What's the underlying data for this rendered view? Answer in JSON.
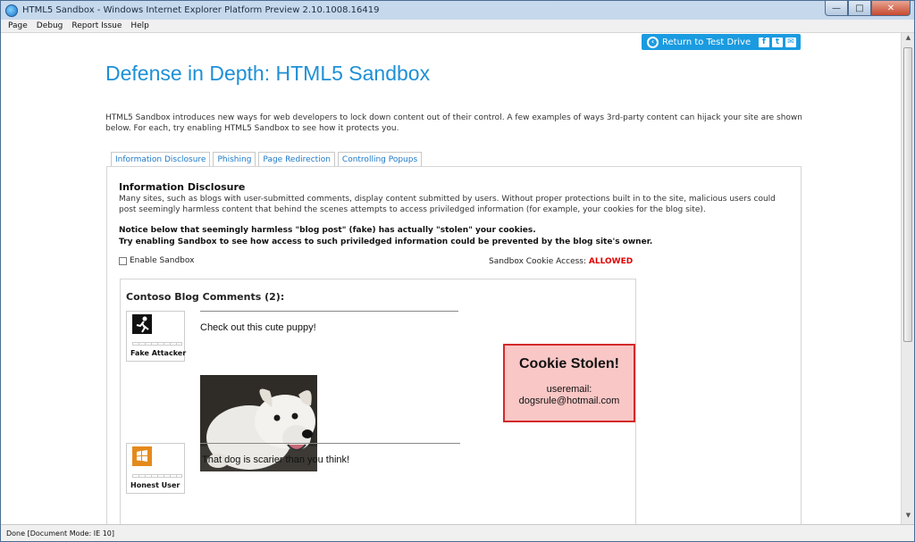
{
  "window": {
    "title": "HTML5 Sandbox - Windows Internet Explorer Platform Preview 2.10.1008.16419"
  },
  "menu": [
    "Page",
    "Debug",
    "Report Issue",
    "Help"
  ],
  "toolbar": {
    "return_label": "Return to Test Drive"
  },
  "page": {
    "title": "Defense in Depth: HTML5 Sandbox",
    "intro": "HTML5 Sandbox introduces new ways for web developers to lock down content out of their control. A few examples of ways 3rd-party content can hijack your site are shown below. For each, try enabling HTML5 Sandbox to see how it protects you."
  },
  "tabs": [
    "Information Disclosure",
    "Phishing",
    "Page Redirection",
    "Controlling Popups"
  ],
  "panel": {
    "title": "Information Disclosure",
    "description": "Many sites, such as blogs with user-submitted comments, display content submitted by users. Without proper protections built in to the site, malicious users could post seemingly harmless content that behind the scenes attempts to access priviledged information (for example, your cookies for the blog site).",
    "notice_line1": "Notice below that seemingly harmless \"blog post\" (fake) has actually \"stolen\" your cookies.",
    "notice_line2": "Try enabling Sandbox to see how access to such priviledged information could be prevented by the blog site's owner.",
    "enable_sandbox_label": "Enable Sandbox",
    "cookie_access_label": "Sandbox Cookie Access:",
    "cookie_access_value": "ALLOWED"
  },
  "blog": {
    "title": "Contoso Blog Comments (2):",
    "comments": [
      {
        "author": "Fake Attacker",
        "text": "Check out this cute puppy!"
      },
      {
        "author": "Honest User",
        "text": "That dog is scarier than you think!"
      }
    ]
  },
  "stolen": {
    "title": "Cookie Stolen!",
    "line1": "useremail:",
    "line2": "dogsrule@hotmail.com"
  },
  "status": {
    "text": "Done [Document Mode: IE 10]"
  },
  "colors": {
    "accent": "#1e90d6",
    "alert": "#e00000",
    "stolen_bg": "#f9c7c6"
  }
}
